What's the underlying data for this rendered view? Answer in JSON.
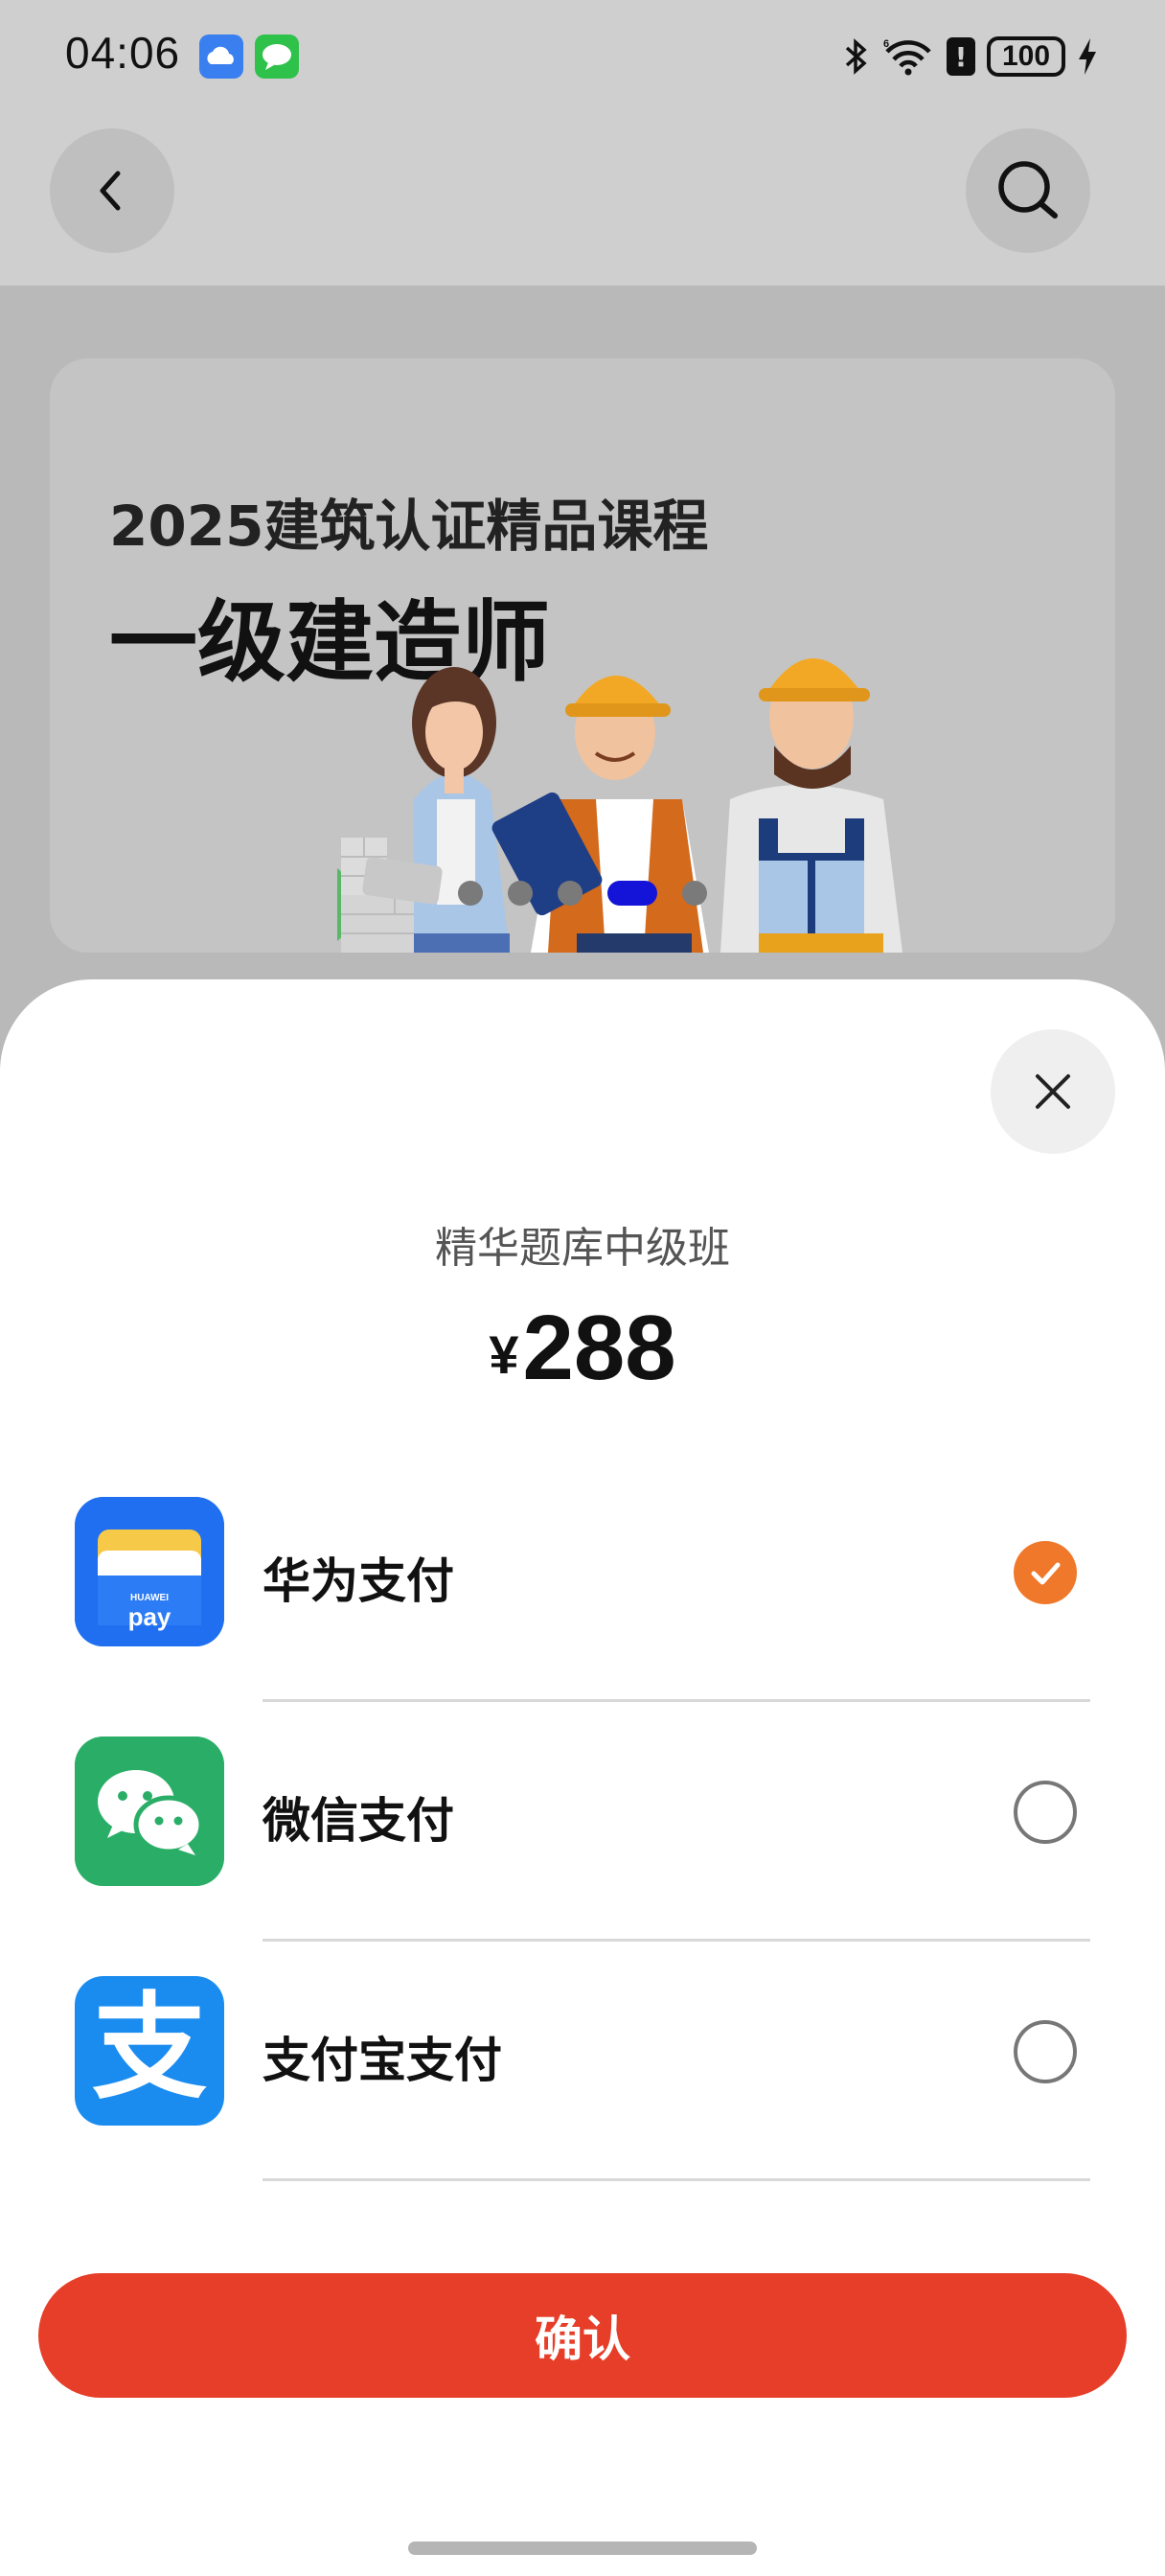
{
  "status_bar": {
    "time": "04:06",
    "battery": "100",
    "alert": "!",
    "icons": [
      "cloud-app-icon",
      "message-app-icon",
      "bluetooth-icon",
      "wifi-icon",
      "alert-icon",
      "battery-icon",
      "charging-icon"
    ]
  },
  "app_bar": {
    "back_icon": "chevron-left-icon",
    "search_icon": "search-icon"
  },
  "banner": {
    "subtitle": "2025建筑认证精品课程",
    "title": "一级建造师",
    "carousel_dots": 5,
    "active_dot": 3
  },
  "sheet": {
    "close_icon": "close-icon",
    "product_name": "精华题库中级班",
    "currency": "¥",
    "price": "288",
    "payment_methods": [
      {
        "label": "华为支付",
        "icon": "huawei-pay-icon",
        "icon_text": "HUAWEI",
        "icon_text2": "pay",
        "selected": true,
        "color": "#1f6ff0"
      },
      {
        "label": "微信支付",
        "icon": "wechat-pay-icon",
        "selected": false,
        "color": "#2aae67"
      },
      {
        "label": "支付宝支付",
        "icon": "alipay-icon",
        "icon_text": "支",
        "selected": false,
        "color": "#1a8cf0"
      }
    ],
    "confirm_label": "确认"
  },
  "colors": {
    "accent_check": "#f0782a",
    "confirm_button": "#e63e28",
    "active_dot": "#1414d8"
  }
}
